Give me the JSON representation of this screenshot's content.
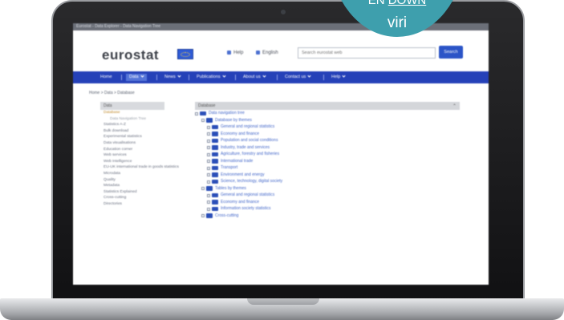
{
  "badge": {
    "prefix": "EN",
    "link": "DOWN",
    "label": "viri"
  },
  "screen": {
    "window_title": "Eurostat - Data Explorer - Data Navigation Tree",
    "logo": "eurostat",
    "links": {
      "help": "Help",
      "english": "English"
    },
    "search": {
      "placeholder": "Search eurostat web",
      "button": "Search"
    },
    "nav": [
      "Home",
      "Data",
      "News",
      "Publications",
      "About us",
      "Contact us",
      "Help"
    ],
    "breadcrumb": "Home  >  Data  >  Database",
    "sidebar": {
      "heading": "Data",
      "items": [
        {
          "label": "Database",
          "state": "active"
        },
        {
          "label": "Data Navigation Tree",
          "state": "sub"
        },
        {
          "label": "Statistics A-Z",
          "state": ""
        },
        {
          "label": "Bulk download",
          "state": ""
        },
        {
          "label": "Experimental statistics",
          "state": ""
        },
        {
          "label": "Data visualisations",
          "state": ""
        },
        {
          "label": "Education corner",
          "state": ""
        },
        {
          "label": "Web services",
          "state": ""
        },
        {
          "label": "Web Intelligence",
          "state": ""
        },
        {
          "label": "EU-UK international trade in goods statistics",
          "state": ""
        },
        {
          "label": "Microdata",
          "state": ""
        },
        {
          "label": "Quality",
          "state": ""
        },
        {
          "label": "Metadata",
          "state": ""
        },
        {
          "label": "Statistics Explained",
          "state": ""
        },
        {
          "label": "Cross-cutting",
          "state": ""
        },
        {
          "label": "Directories",
          "state": ""
        }
      ]
    },
    "main": {
      "heading": "Database",
      "tree": [
        {
          "label": "Data navigation tree",
          "level": 0
        },
        {
          "label": "Database by themes",
          "level": 1
        },
        {
          "label": "General and regional statistics",
          "level": 2
        },
        {
          "label": "Economy and finance",
          "level": 2
        },
        {
          "label": "Population and social conditions",
          "level": 2
        },
        {
          "label": "Industry, trade and services",
          "level": 2
        },
        {
          "label": "Agriculture, forestry and fisheries",
          "level": 2
        },
        {
          "label": "International trade",
          "level": 2
        },
        {
          "label": "Transport",
          "level": 2
        },
        {
          "label": "Environment and energy",
          "level": 2
        },
        {
          "label": "Science, technology, digital society",
          "level": 2
        },
        {
          "label": "Tables by themes",
          "level": 1
        },
        {
          "label": "General and regional statistics",
          "level": 2
        },
        {
          "label": "Economy and finance",
          "level": 2
        },
        {
          "label": "Information society statistics",
          "level": 2
        },
        {
          "label": "Cross-cutting",
          "level": 1
        }
      ]
    }
  },
  "colors": {
    "nav": "#2541b8",
    "badge": "#3e9fad",
    "accent": "#2b54c7"
  }
}
